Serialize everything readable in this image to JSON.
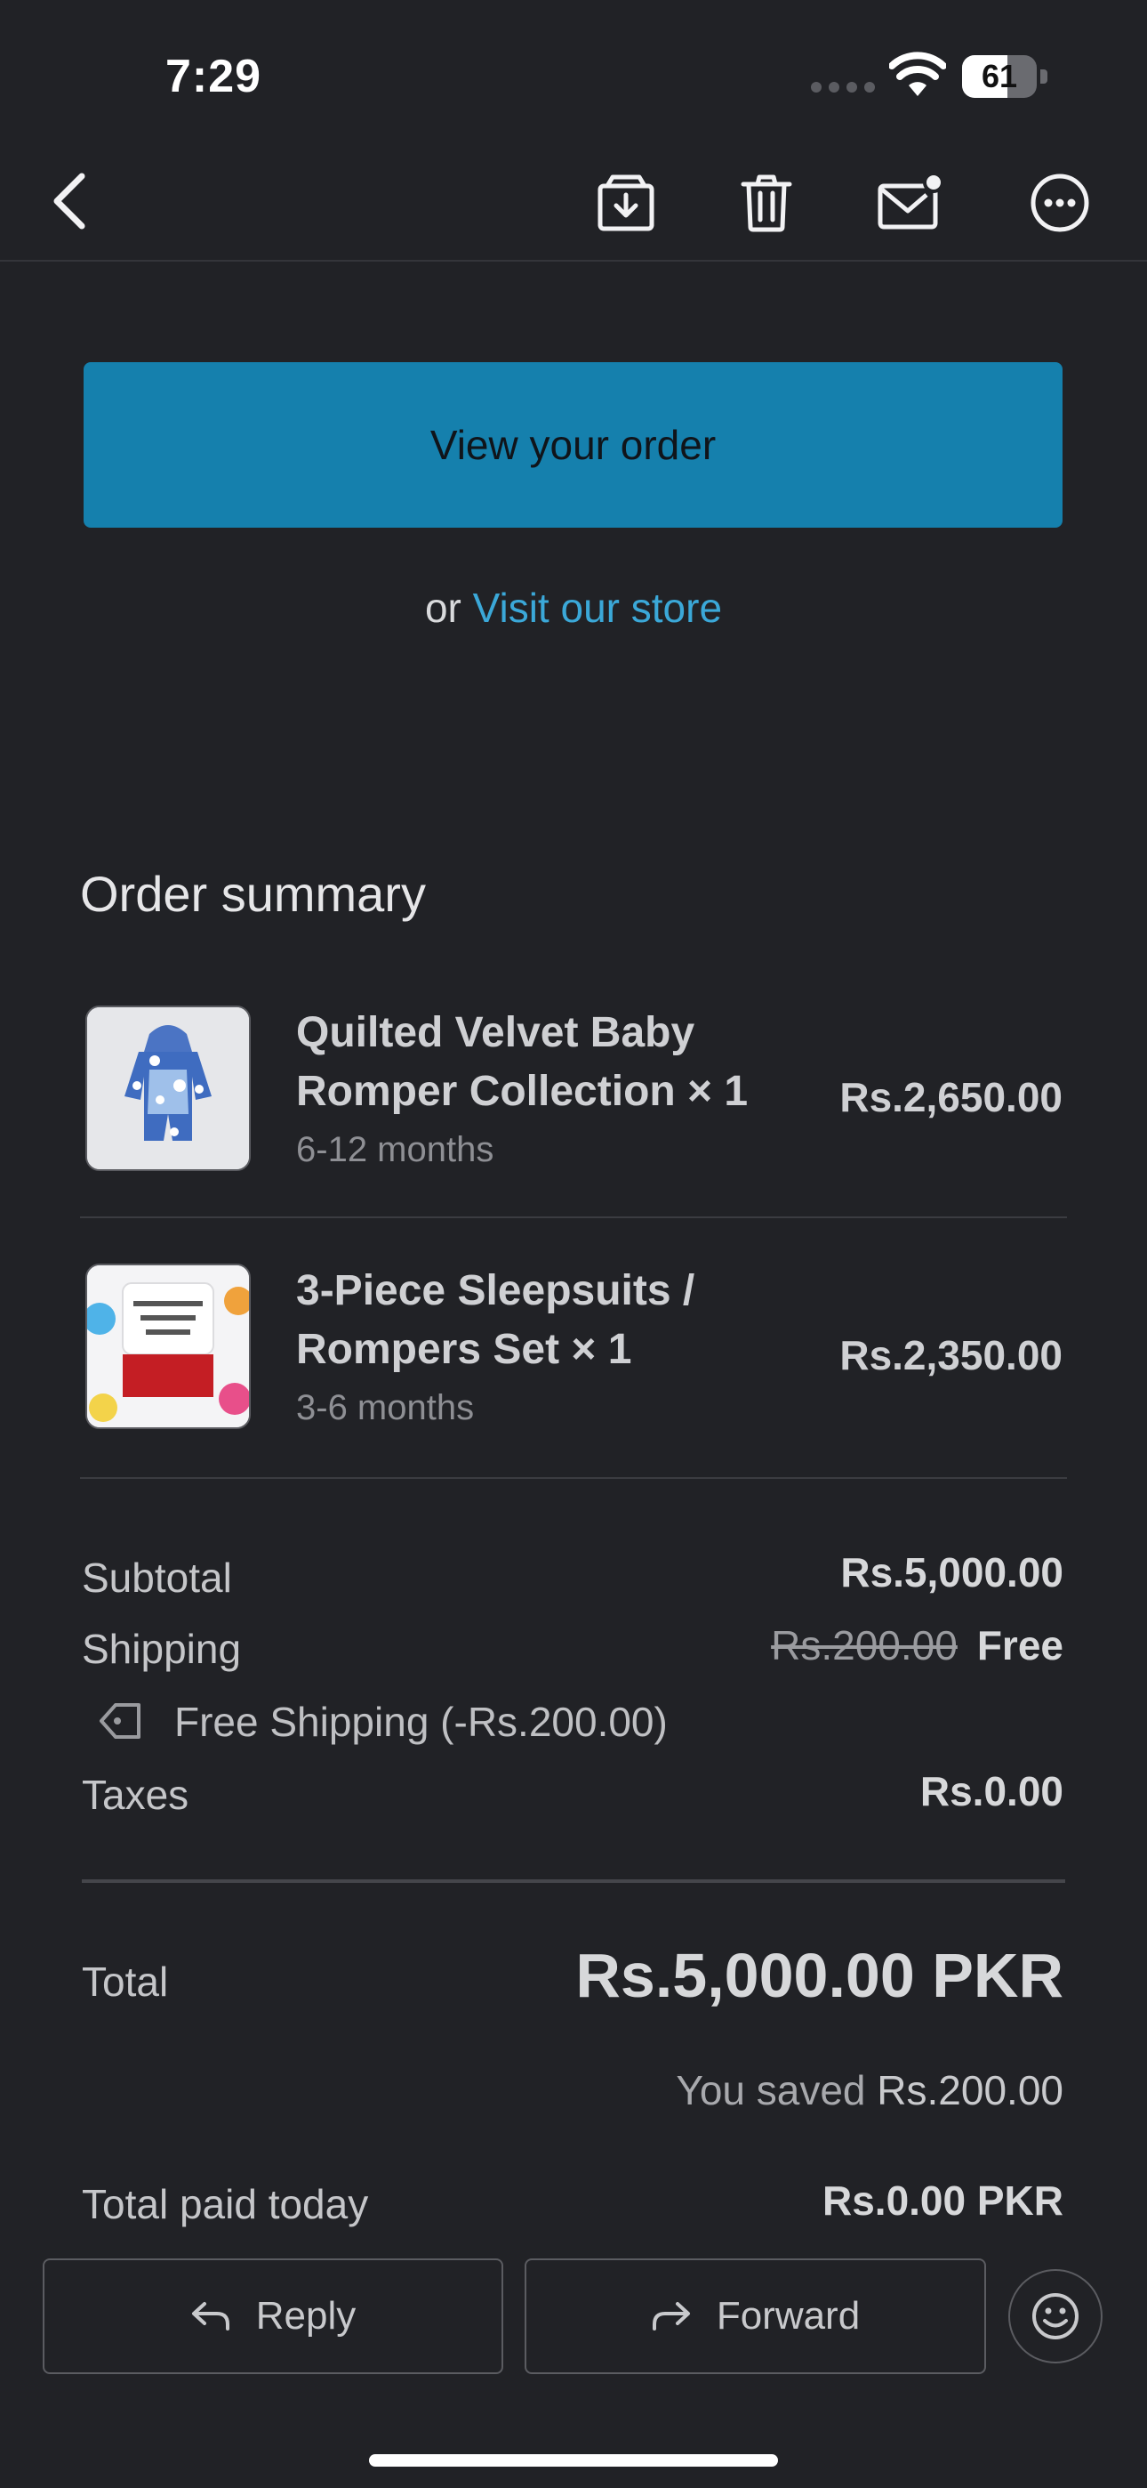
{
  "status_bar": {
    "time": "7:29",
    "battery": "61",
    "battery_level": 0.61
  },
  "toolbar": {
    "back_icon": "chevron-left-icon",
    "archive_icon": "archive-icon",
    "delete_icon": "trash-icon",
    "mark_unread_icon": "mail-unread-icon",
    "more_icon": "more-icon"
  },
  "email": {
    "view_order_label": "View your order",
    "or_text": "or",
    "visit_store_label": "Visit our store",
    "order_summary_title": "Order summary",
    "items": [
      {
        "name": "Quilted Velvet Baby Romper Collection × 1",
        "variant": "6-12 months",
        "price": "Rs.2,650.00"
      },
      {
        "name": "3-Piece Sleepsuits / Rompers Set × 1",
        "variant": "3-6 months",
        "price": "Rs.2,350.00"
      }
    ],
    "subtotal_label": "Subtotal",
    "subtotal_value": "Rs.5,000.00",
    "shipping_label": "Shipping",
    "shipping_original": "Rs.200.00",
    "shipping_value": "Free",
    "discount_text": "Free Shipping (-Rs.200.00)",
    "taxes_label": "Taxes",
    "taxes_value": "Rs.0.00",
    "total_label": "Total",
    "total_value": "Rs.5,000.00 PKR",
    "saved_prefix": "You saved",
    "saved_amount": "Rs.200.00",
    "paid_today_label": "Total paid today",
    "paid_today_value": "Rs.0.00 PKR"
  },
  "bottom_bar": {
    "reply_label": "Reply",
    "forward_label": "Forward"
  },
  "colors": {
    "background": "#212226",
    "accent": "#1580ad",
    "link": "#3ba8d8"
  }
}
